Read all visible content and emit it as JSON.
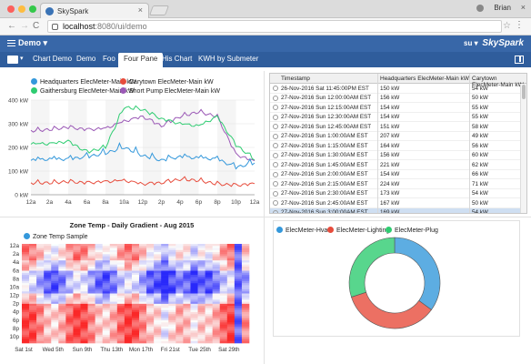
{
  "browser": {
    "tab_title": "SkySpark",
    "tab_close": "×",
    "user": "Brian",
    "url_host": "localhost",
    "url_path": ":8080/ui/demo",
    "back": "←",
    "forward": "→",
    "reload": "C",
    "star": "☆",
    "menu": "⋮",
    "close": "×"
  },
  "app": {
    "project": "Demo",
    "user": "su",
    "brand": "SkySpark"
  },
  "tabs": [
    "Chart Demo",
    "Demo",
    "Foo",
    "Four Pane",
    "His Chart",
    "KWH by Submeter"
  ],
  "active_tab": "Four Pane",
  "line_chart": {
    "legend": [
      {
        "name": "Headquarters ElecMeter-Main kW",
        "color": "#3498db"
      },
      {
        "name": "Carytown ElecMeter-Main kW",
        "color": "#e74c3c"
      },
      {
        "name": "Gaithersburg ElecMeter-Main kW",
        "color": "#2ecc71"
      },
      {
        "name": "Short Pump ElecMeter-Main kW",
        "color": "#9b59b6"
      }
    ],
    "y_ticks": [
      "400 kW",
      "300 kW",
      "200 kW",
      "100 kW",
      "0 kW"
    ],
    "x_ticks": [
      "12a",
      "2a",
      "4a",
      "6a",
      "8a",
      "10a",
      "12p",
      "2p",
      "4p",
      "6p",
      "8p",
      "10p",
      "12a"
    ]
  },
  "chart_data": [
    {
      "type": "line",
      "ylim": [
        0,
        400
      ],
      "x": [
        "12a",
        "2a",
        "4a",
        "6a",
        "8a",
        "10a",
        "12p",
        "2p",
        "4p",
        "6p",
        "8p",
        "10p",
        "12a"
      ],
      "series": [
        {
          "name": "Headquarters ElecMeter-Main kW",
          "values": [
            145,
            150,
            150,
            160,
            175,
            200,
            165,
            145,
            160,
            155,
            150,
            115,
            135
          ]
        },
        {
          "name": "Carytown ElecMeter-Main kW",
          "values": [
            50,
            50,
            55,
            50,
            55,
            60,
            45,
            50,
            65,
            60,
            45,
            40,
            45
          ]
        },
        {
          "name": "Gaithersburg ElecMeter-Main kW",
          "values": [
            215,
            215,
            225,
            180,
            200,
            370,
            360,
            320,
            300,
            290,
            330,
            210,
            150
          ]
        },
        {
          "name": "Short Pump ElecMeter-Main kW",
          "values": [
            270,
            275,
            285,
            275,
            280,
            310,
            330,
            290,
            330,
            350,
            330,
            170,
            140
          ]
        }
      ]
    },
    {
      "type": "heatmap",
      "title": "Zone Temp - Daily Gradient - Aug 2015",
      "series_name": "Zone Temp Sample",
      "y_labels": [
        "12a",
        "2a",
        "4a",
        "6a",
        "8a",
        "10a",
        "12p",
        "2p",
        "4p",
        "6p",
        "8p",
        "10p"
      ],
      "x_labels": [
        "Sat 1st",
        "Wed 5th",
        "Sun 9th",
        "Thu 13th",
        "Mon 17th",
        "Fri 21st",
        "Tue 25th",
        "Sat 29th"
      ]
    },
    {
      "type": "pie",
      "donut": true,
      "labels": [
        "ElecMeter-Hvac",
        "ElecMeter-Lighting",
        "ElecMeter-Plug"
      ],
      "colors": [
        "#5dade2",
        "#ec7063",
        "#58d68d"
      ],
      "values": [
        35,
        35,
        30
      ]
    }
  ],
  "table": {
    "columns": [
      "Timestamp",
      "Headquarters ElecMeter-Main kW",
      "Carytown ElecMeter-Main kW"
    ],
    "rows": [
      [
        "26-Nov-2016 Sat 11:45:00PM EST",
        "150 kW",
        "54 kW"
      ],
      [
        "27-Nov-2016 Sun 12:00:00AM EST",
        "156 kW",
        "50 kW"
      ],
      [
        "27-Nov-2016 Sun 12:15:00AM EST",
        "154 kW",
        "55 kW"
      ],
      [
        "27-Nov-2016 Sun 12:30:00AM EST",
        "154 kW",
        "55 kW"
      ],
      [
        "27-Nov-2016 Sun 12:45:00AM EST",
        "151 kW",
        "58 kW"
      ],
      [
        "27-Nov-2016 Sun 1:00:00AM EST",
        "207 kW",
        "49 kW"
      ],
      [
        "27-Nov-2016 Sun 1:15:00AM EST",
        "164 kW",
        "56 kW"
      ],
      [
        "27-Nov-2016 Sun 1:30:00AM EST",
        "156 kW",
        "60 kW"
      ],
      [
        "27-Nov-2016 Sun 1:45:00AM EST",
        "221 kW",
        "62 kW"
      ],
      [
        "27-Nov-2016 Sun 2:00:00AM EST",
        "154 kW",
        "66 kW"
      ],
      [
        "27-Nov-2016 Sun 2:15:00AM EST",
        "224 kW",
        "71 kW"
      ],
      [
        "27-Nov-2016 Sun 2:30:00AM EST",
        "173 kW",
        "54 kW"
      ],
      [
        "27-Nov-2016 Sun 2:45:00AM EST",
        "167 kW",
        "50 kW"
      ],
      [
        "27-Nov-2016 Sun 3:00:00AM EST",
        "169 kW",
        "54 kW"
      ]
    ]
  },
  "heatmap": {
    "title": "Zone Temp - Daily Gradient - Aug 2015",
    "legend": "Zone Temp Sample",
    "legend_color": "#3498db"
  },
  "donut": {
    "legend": [
      {
        "name": "ElecMeter-Hvac",
        "color": "#3498db"
      },
      {
        "name": "ElecMeter-Lighting",
        "color": "#e74c3c"
      },
      {
        "name": "ElecMeter-Plug",
        "color": "#2ecc71"
      }
    ]
  }
}
